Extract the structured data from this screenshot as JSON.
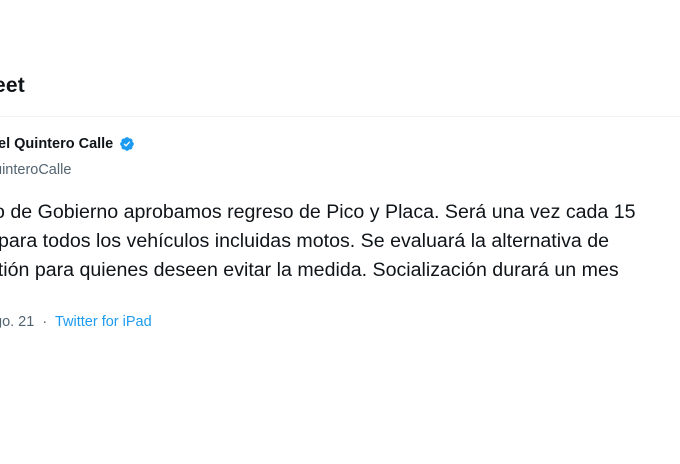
{
  "header": {
    "title": "eet"
  },
  "author": {
    "name": "iel Quintero Calle",
    "handle": "uinteroCalle",
    "verified": true,
    "verified_icon": "verified-badge-icon",
    "verified_color": "#1d9bf0"
  },
  "tweet": {
    "lines": [
      "o de Gobierno aprobamos regreso de Pico y Placa. Será una vez cada 15",
      "para todos los vehículos incluidas motos. Se evaluará la alternativa de",
      "stión para quienes deseen evitar la medida. Socialización durará un mes"
    ]
  },
  "meta": {
    "date": "go. 21",
    "separator": "·",
    "source": "Twitter for iPad",
    "source_color": "#1d9bf0"
  }
}
